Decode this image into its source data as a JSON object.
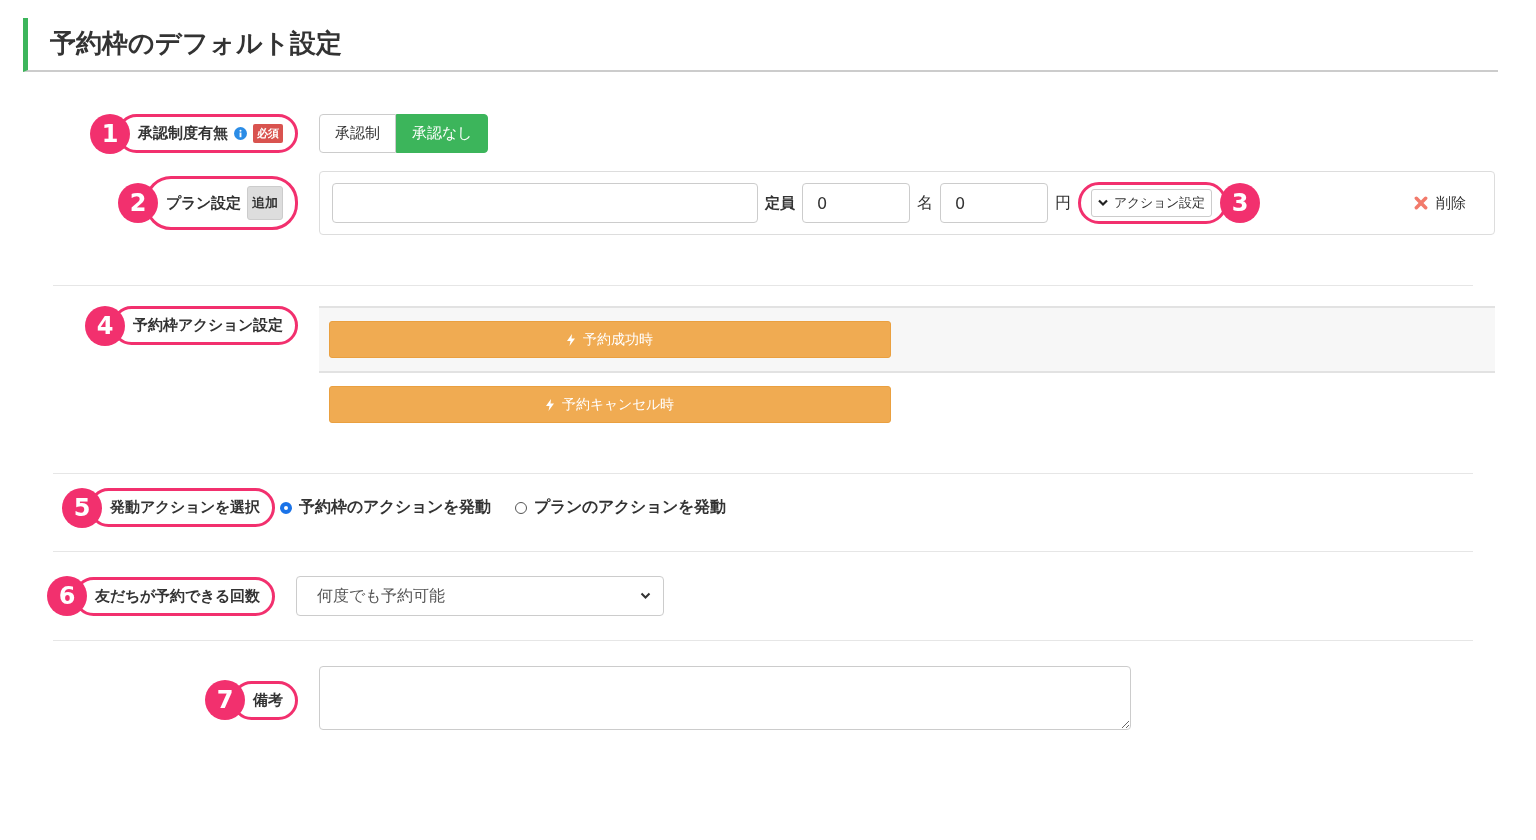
{
  "title": "予約枠のデフォルト設定",
  "approval": {
    "callout": "1",
    "label": "承認制度有無",
    "required_badge": "必須",
    "options": [
      {
        "label": "承認制",
        "selected": false
      },
      {
        "label": "承認なし",
        "selected": true
      }
    ]
  },
  "plan": {
    "callout": "2",
    "label": "プラン設定",
    "add_button": "追加",
    "capacity_label": "定員",
    "capacity_value": "0",
    "capacity_unit": "名",
    "price_value": "0",
    "price_unit": "円",
    "action_button": "アクション設定",
    "action_callout": "3",
    "delete_button": "削除"
  },
  "slot_actions": {
    "callout": "4",
    "label": "予約枠アクション設定",
    "buttons": [
      "予約成功時",
      "予約キャンセル時"
    ]
  },
  "trigger": {
    "callout": "5",
    "label": "発動アクションを選択",
    "options": [
      {
        "label": "予約枠のアクションを発動",
        "selected": true
      },
      {
        "label": "プランのアクションを発動",
        "selected": false
      }
    ]
  },
  "limit": {
    "callout": "6",
    "label": "友だちが予約できる回数",
    "value": "何度でも予約可能"
  },
  "note": {
    "callout": "7",
    "label": "備考"
  }
}
